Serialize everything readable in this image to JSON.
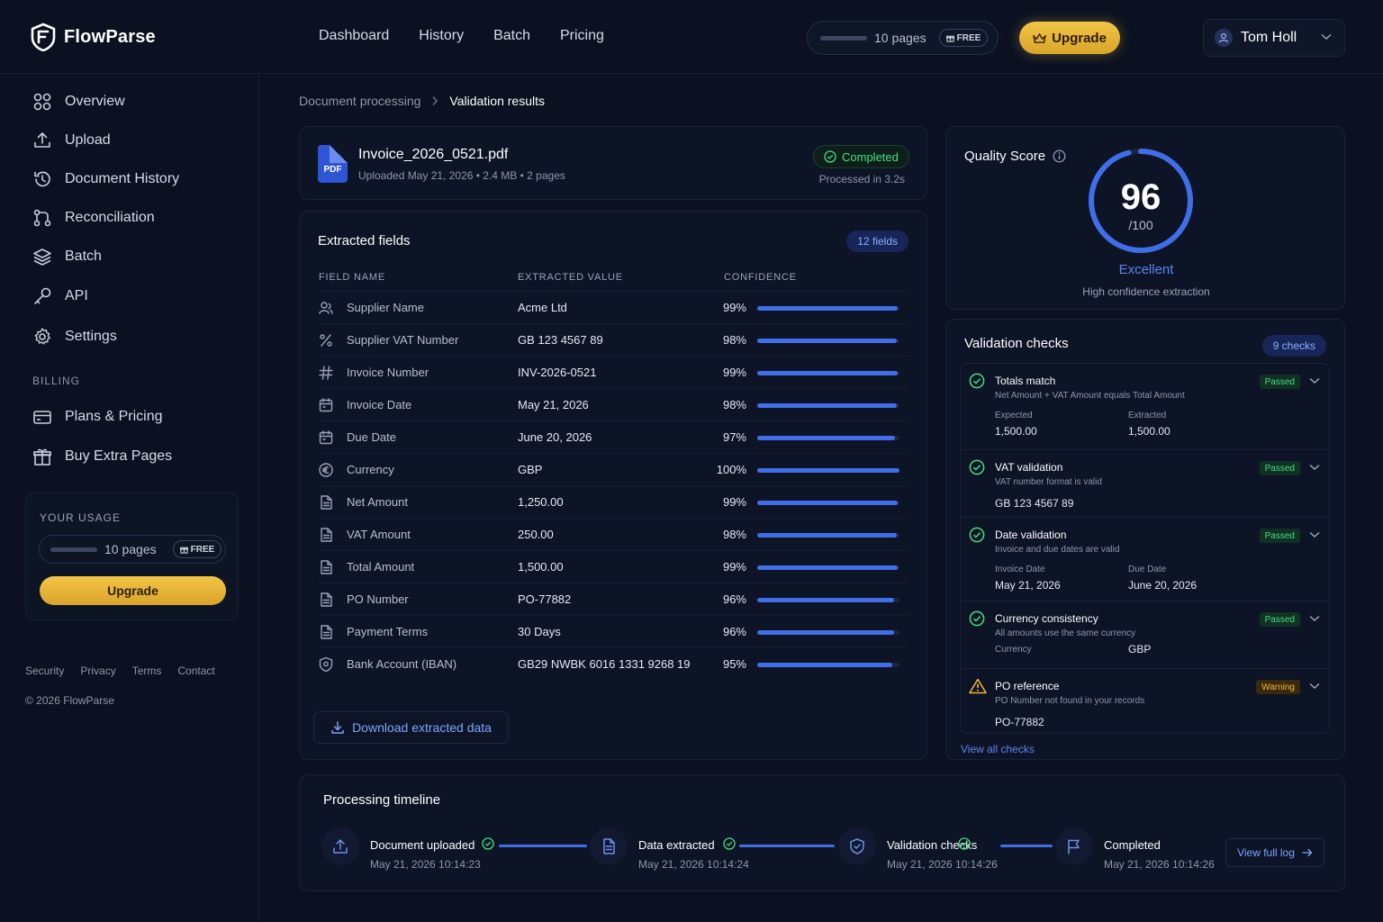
{
  "app": {
    "name": "FlowParse"
  },
  "nav": [
    "Dashboard",
    "History",
    "Batch",
    "Pricing"
  ],
  "usage": {
    "pages_text": "10 pages",
    "badge": "FREE",
    "fill_fraction": 0.0
  },
  "upgrade_label": "Upgrade",
  "user": {
    "name": "Tom Holl"
  },
  "sidebar": {
    "items": [
      {
        "label": "Overview",
        "icon": "grid-icon"
      },
      {
        "label": "Upload",
        "icon": "upload-icon"
      },
      {
        "label": "Document History",
        "icon": "history-icon"
      },
      {
        "label": "Reconciliation",
        "icon": "reconcile-icon"
      },
      {
        "label": "Batch",
        "icon": "layers-icon"
      },
      {
        "label": "API",
        "icon": "key-icon"
      },
      {
        "label": "Settings",
        "icon": "gear-icon"
      }
    ],
    "billing_heading": "BILLING",
    "billing_items": [
      {
        "label": "Plans & Pricing",
        "icon": "card-icon"
      },
      {
        "label": "Buy Extra Pages",
        "icon": "gift-icon"
      }
    ],
    "usage_heading": "YOUR USAGE",
    "footer_links": [
      "Security",
      "Privacy",
      "Terms",
      "Contact"
    ],
    "copyright": "© 2026 FlowParse"
  },
  "breadcrumb": [
    "Document processing",
    "Validation results"
  ],
  "file": {
    "name": "Invoice_2026_0521.pdf",
    "meta": "Uploaded May 21, 2026 • 2.4 MB • 2 pages",
    "icon_label": "PDF",
    "status": "Completed",
    "processed": "Processed in 3.2s"
  },
  "fields": {
    "title": "Extracted fields",
    "count": "12 fields",
    "headers": [
      "FIELD NAME",
      "EXTRACTED VALUE",
      "CONFIDENCE"
    ],
    "rows": [
      {
        "name": "Supplier Name",
        "value": "Acme Ltd",
        "confidence": "99%",
        "pct": 99,
        "icon": "user-icon"
      },
      {
        "name": "Supplier VAT Number",
        "value": "GB 123 4567 89",
        "confidence": "98%",
        "pct": 98,
        "icon": "percent-icon"
      },
      {
        "name": "Invoice Number",
        "value": "INV-2026-0521",
        "confidence": "99%",
        "pct": 99,
        "icon": "hash-icon"
      },
      {
        "name": "Invoice Date",
        "value": "May 21, 2026",
        "confidence": "98%",
        "pct": 98,
        "icon": "calendar-icon"
      },
      {
        "name": "Due Date",
        "value": "June 20, 2026",
        "confidence": "97%",
        "pct": 97,
        "icon": "calendar-icon"
      },
      {
        "name": "Currency",
        "value": "GBP",
        "confidence": "100%",
        "pct": 100,
        "icon": "euro-icon"
      },
      {
        "name": "Net Amount",
        "value": "1,250.00",
        "confidence": "99%",
        "pct": 99,
        "icon": "document-icon"
      },
      {
        "name": "VAT Amount",
        "value": "250.00",
        "confidence": "98%",
        "pct": 98,
        "icon": "document-icon"
      },
      {
        "name": "Total Amount",
        "value": "1,500.00",
        "confidence": "99%",
        "pct": 99,
        "icon": "document-icon"
      },
      {
        "name": "PO Number",
        "value": "PO-77882",
        "confidence": "96%",
        "pct": 96,
        "icon": "document-icon"
      },
      {
        "name": "Payment Terms",
        "value": "30 Days",
        "confidence": "96%",
        "pct": 96,
        "icon": "document-icon"
      },
      {
        "name": "Bank Account (IBAN)",
        "value": "GB29 NWBK 6016 1331 9268 19",
        "confidence": "95%",
        "pct": 95,
        "icon": "shield-icon"
      }
    ],
    "download_label": "Download extracted data"
  },
  "quality": {
    "title": "Quality Score",
    "score": "96",
    "max": "/100",
    "score_fraction": 0.96,
    "label": "Excellent",
    "sub": "High confidence extraction"
  },
  "validation": {
    "title": "Validation checks",
    "count": "9 checks",
    "checks": [
      {
        "title": "Totals match",
        "desc": "Net Amount + VAT Amount equals Total Amount",
        "status": "Passed",
        "kv": [
          {
            "label": "Expected",
            "value": "1,500.00"
          },
          {
            "label": "Extracted",
            "value": "1,500.00"
          }
        ]
      },
      {
        "title": "VAT validation",
        "desc": "VAT number format is valid",
        "status": "Passed",
        "kv": [
          {
            "label": "",
            "value": "GB 123 4567 89"
          }
        ]
      },
      {
        "title": "Date validation",
        "desc": "Invoice and due dates are valid",
        "status": "Passed",
        "kv": [
          {
            "label": "Invoice Date",
            "value": "May 21, 2026"
          },
          {
            "label": "Due Date",
            "value": "June 20, 2026"
          }
        ]
      },
      {
        "title": "Currency consistency",
        "desc": "All amounts use the same currency",
        "status": "Passed",
        "kv": [
          {
            "label": "Currency",
            "value": "GBP"
          }
        ]
      },
      {
        "title": "PO reference",
        "desc": "PO Number not found in your records",
        "status": "Warning",
        "kv": [
          {
            "label": "",
            "value": "PO-77882"
          }
        ]
      }
    ],
    "view_all": "View all checks"
  },
  "timeline": {
    "title": "Processing timeline",
    "steps": [
      {
        "title": "Document uploaded",
        "time": "May 21, 2026 10:14:23",
        "icon": "upload-icon"
      },
      {
        "title": "Data extracted",
        "time": "May 21, 2026 10:14:24",
        "icon": "document-icon"
      },
      {
        "title": "Validation checks",
        "time": "May 21, 2026 10:14:26",
        "icon": "shield-icon"
      },
      {
        "title": "Completed",
        "time": "May 21, 2026 10:14:26",
        "icon": "flag-icon"
      }
    ],
    "view_log": "View full log"
  },
  "colors": {
    "accent": "#3f6ee8",
    "gold": "#f2c546",
    "success": "#4ade80",
    "warning": "#f4b63f",
    "background": "#0b1120"
  }
}
